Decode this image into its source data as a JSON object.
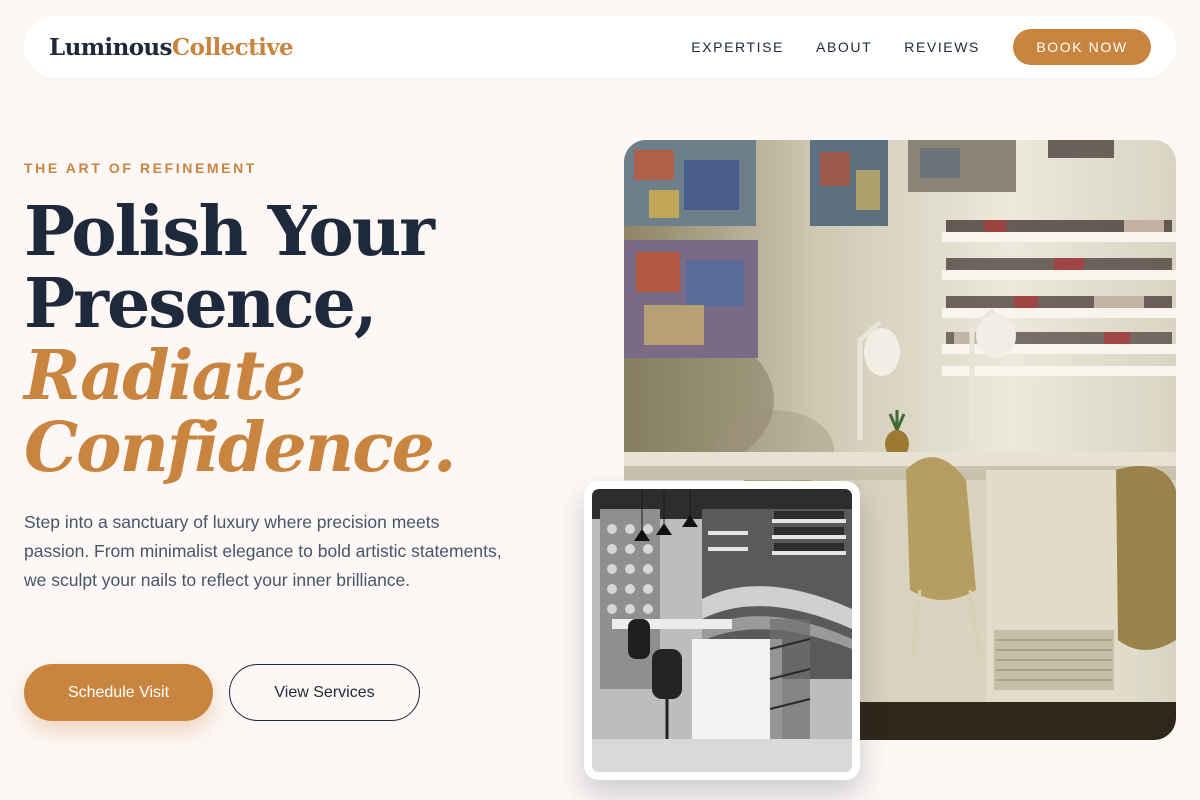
{
  "nav": {
    "logo_primary": "Luminous",
    "logo_secondary": "Collective",
    "links": [
      "EXPERTISE",
      "ABOUT",
      "REVIEWS"
    ],
    "cta": "BOOK NOW"
  },
  "hero": {
    "eyebrow": "THE ART OF REFINEMENT",
    "headline": {
      "line1": "Polish Your",
      "line2": "Presence,",
      "line3": "Radiate",
      "line4": "Confidence."
    },
    "description": "Step into a sanctuary of luxury where precision meets passion. From minimalist elegance to bold artistic statements, we sculpt your nails to reflect your inner brilliance.",
    "primary_button": "Schedule Visit",
    "secondary_button": "View Services"
  },
  "images": {
    "main_alt": "salon-interior-photo",
    "inset_alt": "salon-interior-bw-photo"
  },
  "colors": {
    "background": "#fdf8f6",
    "accent": "#c98540",
    "dark": "#1e293b",
    "body_text": "#475569"
  }
}
